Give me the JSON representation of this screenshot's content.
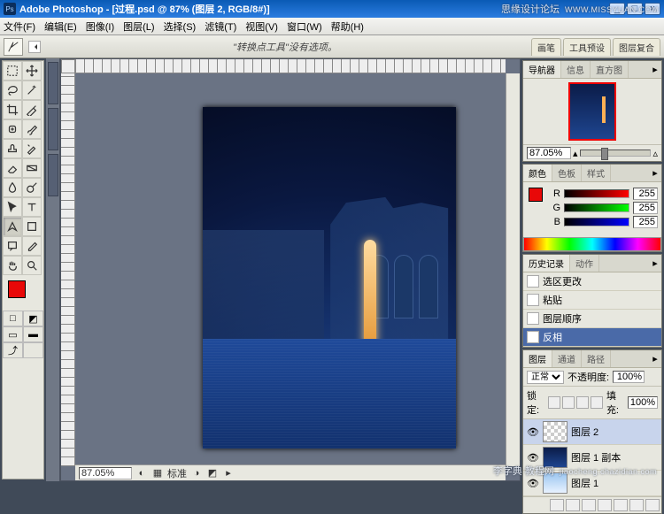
{
  "title": "Adobe Photoshop - [过程.psd @ 87% (图层 2, RGB/8#)]",
  "menubar": [
    "文件(F)",
    "编辑(E)",
    "图像(I)",
    "图层(L)",
    "选择(S)",
    "滤镜(T)",
    "视图(V)",
    "窗口(W)",
    "帮助(H)"
  ],
  "optbar": {
    "msg": "\"转换点工具\"没有选项。",
    "rightTabs": [
      "画笔",
      "工具预设",
      "图层复合"
    ]
  },
  "status": {
    "zoom": "87.05%",
    "label": "标准"
  },
  "watermark_top": {
    "main": "思缘设计论坛",
    "url": "WWW.MISSYUAN.COM"
  },
  "watermark_bottom": {
    "main": "李字典 教程网",
    "url": "jiaocheng.chazidian.com"
  },
  "panels": {
    "nav": {
      "tabs": [
        "导航器",
        "信息",
        "直方图"
      ],
      "active": 0,
      "pct": "87.05%"
    },
    "color": {
      "tabs": [
        "颜色",
        "色板",
        "样式"
      ],
      "active": 0,
      "r": "255",
      "g": "255",
      "b": "255"
    },
    "history": {
      "tabs": [
        "历史记录",
        "动作"
      ],
      "active": 0,
      "items": [
        "选区更改",
        "粘贴",
        "图层顺序",
        "反相"
      ],
      "selected": 3
    },
    "layers": {
      "tabs": [
        "图层",
        "通道",
        "路径"
      ],
      "active": 0,
      "blend": "正常",
      "opacityLabel": "不透明度:",
      "opacity": "100%",
      "lockLabel": "锁定:",
      "fillLabel": "填充:",
      "fill": "100%",
      "items": [
        {
          "name": "图层 2",
          "thumb": "chk",
          "sel": true
        },
        {
          "name": "图层 1 副本",
          "thumb": "night"
        },
        {
          "name": "图层 1",
          "thumb": "day"
        }
      ]
    }
  }
}
